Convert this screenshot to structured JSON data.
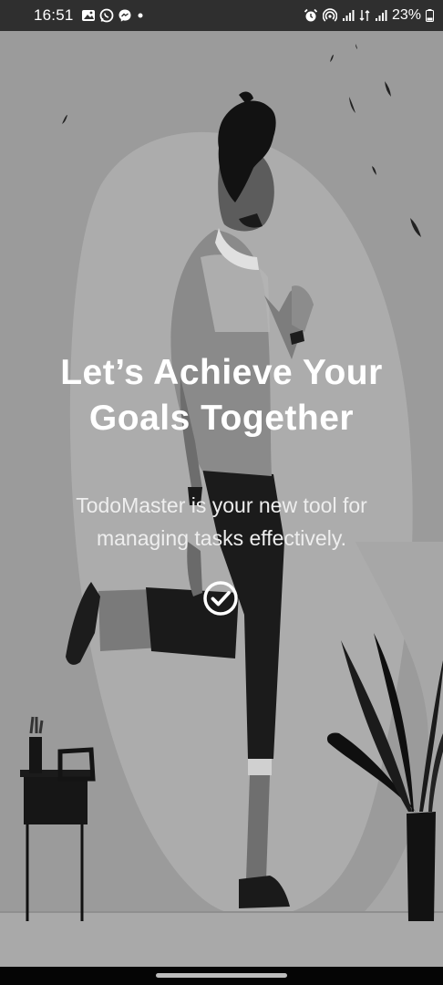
{
  "status_bar": {
    "time": "16:51",
    "left_icons": [
      "gallery-icon",
      "whatsapp-icon",
      "messenger-icon",
      "dot-icon"
    ],
    "right_icons": [
      "alarm-icon",
      "hotspot-icon",
      "signal-icon",
      "data-icon",
      "signal-icon",
      "battery-icon"
    ],
    "battery_percent": "23%"
  },
  "onboarding": {
    "headline_line1": "Let’s Achieve Your",
    "headline_line2": "Goals Together",
    "subtitle_line1": "TodoMaster is your new tool for",
    "subtitle_line2": "managing tasks effectively.",
    "action_icon": "check-circle-icon"
  },
  "colors": {
    "background": "#9a9a9a",
    "status_bar": "#2f2f2f",
    "text": "#ffffff",
    "nav_bar": "#050505"
  }
}
